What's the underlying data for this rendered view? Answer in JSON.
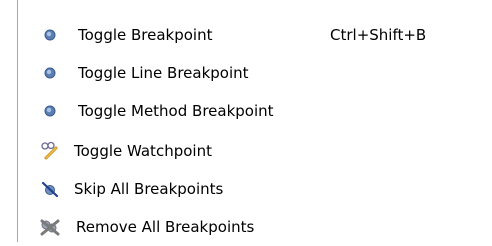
{
  "menu": {
    "items": [
      {
        "label": "Toggle Breakpoint",
        "shortcut": "Ctrl+Shift+B",
        "icon": "breakpoint-dot-icon"
      },
      {
        "label": "Toggle Line Breakpoint",
        "shortcut": "",
        "icon": "breakpoint-dot-icon"
      },
      {
        "label": "Toggle Method Breakpoint",
        "shortcut": "",
        "icon": "breakpoint-dot-icon"
      },
      {
        "label": "Toggle Watchpoint",
        "shortcut": "",
        "icon": "watchpoint-glasses-icon"
      },
      {
        "label": "Skip All Breakpoints",
        "shortcut": "",
        "icon": "skip-breakpoints-icon"
      },
      {
        "label": "Remove All Breakpoints",
        "shortcut": "",
        "icon": "remove-breakpoints-icon"
      }
    ]
  },
  "colors": {
    "breakpoint_fill": "#5b7fb2",
    "breakpoint_highlight": "#a9c3e6",
    "menu_border": "#a8a8a8",
    "text": "#000000"
  }
}
